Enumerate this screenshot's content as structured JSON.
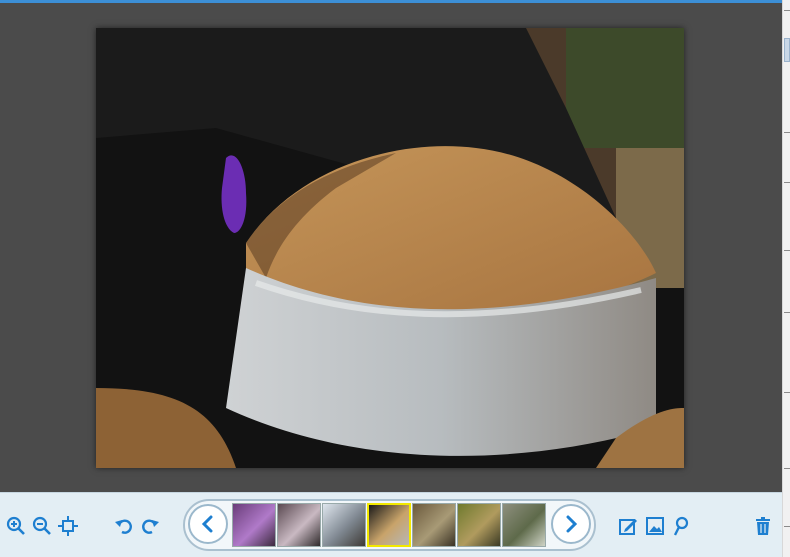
{
  "viewer": {
    "photo_description_icon": "photo-icon"
  },
  "toolbar": {
    "zoom_in": "zoom-in-icon",
    "zoom_out": "zoom-out-icon",
    "fit": "fit-to-window-icon",
    "rotate_left": "rotate-left-icon",
    "rotate_right": "rotate-right-icon",
    "prev": "chevron-left-icon",
    "next": "chevron-right-icon",
    "edit": "edit-icon",
    "slideshow": "image-icon",
    "help": "help-icon",
    "delete": "trash-icon"
  },
  "thumbnails": [
    {
      "colors": [
        "#6a3d7a",
        "#b07ac9",
        "#3b2a3d"
      ],
      "selected": false
    },
    {
      "colors": [
        "#5b4a52",
        "#c9b9c2",
        "#2f2a2b"
      ],
      "selected": false
    },
    {
      "colors": [
        "#dfe6ee",
        "#7f8891",
        "#3e3a36"
      ],
      "selected": false
    },
    {
      "colors": [
        "#1a1a1a",
        "#c8a36a",
        "#b7b7b7"
      ],
      "selected": true
    },
    {
      "colors": [
        "#6b5a3d",
        "#a89a76",
        "#3a3224"
      ],
      "selected": false
    },
    {
      "colors": [
        "#6f7a2e",
        "#b09b5e",
        "#3b3a24"
      ],
      "selected": false
    },
    {
      "colors": [
        "#8e8f7e",
        "#5e6a4a",
        "#cfd3c6"
      ],
      "selected": false
    }
  ],
  "colors": {
    "accent": "#3c8fd6",
    "icon_blue": "#1e7fd0",
    "selection": "#f2e800"
  }
}
